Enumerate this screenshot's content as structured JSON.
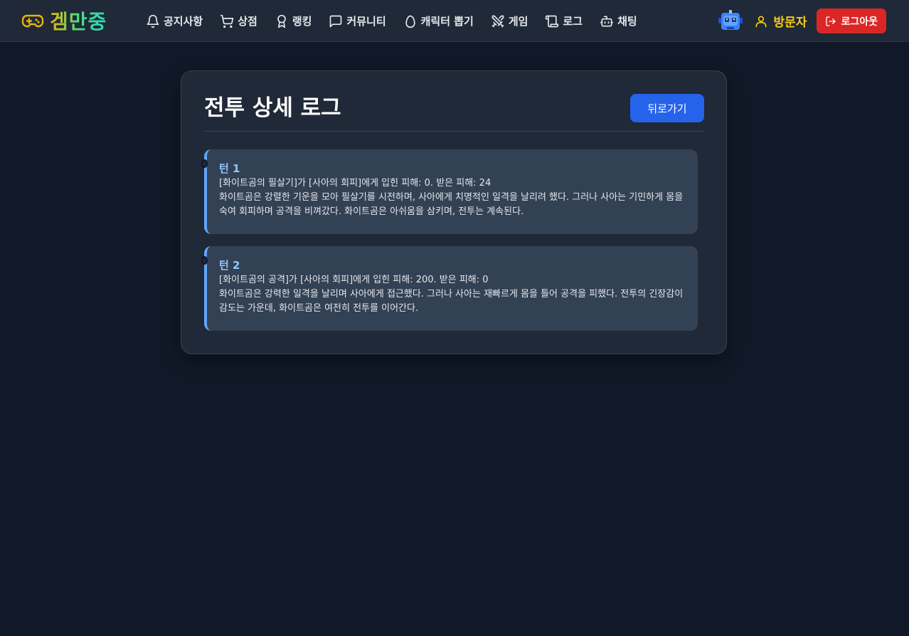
{
  "brand": {
    "name": "겜만중"
  },
  "nav": {
    "items": [
      {
        "label": "공지사항",
        "icon": "bell-icon"
      },
      {
        "label": "상점",
        "icon": "cart-icon"
      },
      {
        "label": "랭킹",
        "icon": "award-icon"
      },
      {
        "label": "커뮤니티",
        "icon": "chat-bubble-icon"
      },
      {
        "label": "캐릭터 뽑기",
        "icon": "egg-icon"
      },
      {
        "label": "게임",
        "icon": "crossed-swords-icon"
      },
      {
        "label": "로그",
        "icon": "scroll-icon"
      },
      {
        "label": "채팅",
        "icon": "bot-icon"
      }
    ]
  },
  "user": {
    "name": "방문자",
    "icon": "user-icon"
  },
  "logout": {
    "label": "로그아웃",
    "icon": "logout-icon"
  },
  "colors": {
    "background": "#111827",
    "navbar": "#1f2937",
    "card": "#1f2937",
    "turn_card": "#334155",
    "accent_blue": "#2563eb",
    "turn_title": "#93c5fd",
    "logout": "#dc2626",
    "user_name": "#facc15"
  },
  "page": {
    "title": "전투 상세 로그",
    "back_label": "뒤로가기"
  },
  "turns": [
    {
      "title": "턴 1",
      "summary": "[화이트곰의 필살기]가 [사아의 회피]에게 입힌 피해: 0. 받은 피해: 24",
      "text": "화이트곰은 강렬한 기운을 모아 필살기를 시전하며, 사아에게 치명적인 일격을 날리려 했다. 그러나 사아는 기민하게 몸을 숙여 회피하며 공격을 비껴갔다. 화이트곰은 아쉬움을 삼키며, 전투는 계속된다."
    },
    {
      "title": "턴 2",
      "summary": "[화이트곰의 공격]가 [사아의 회피]에게 입힌 피해: 200. 받은 피해: 0",
      "text": "화이트곰은 강력한 일격을 날리며 사아에게 접근했다. 그러나 사아는 재빠르게 몸을 틀어 공격을 피했다. 전투의 긴장감이 감도는 가운데, 화이트곰은 여전히 전투를 이어간다."
    }
  ]
}
